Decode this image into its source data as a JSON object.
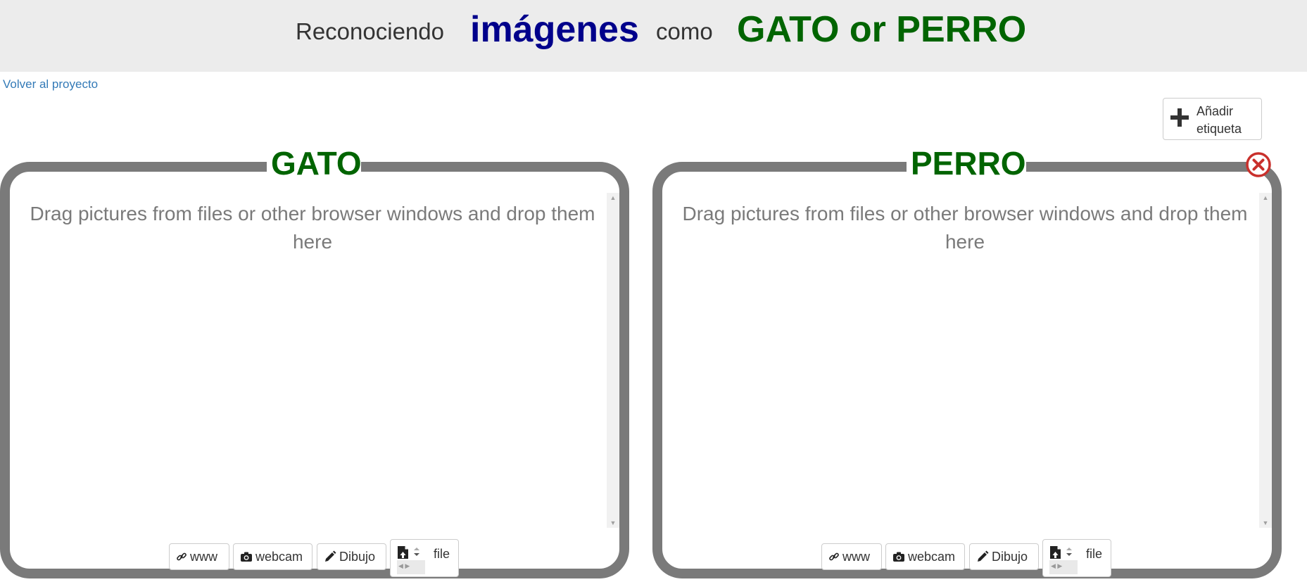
{
  "header": {
    "title_part1": "Reconociendo",
    "title_part2": "imágenes",
    "title_part3": "como",
    "title_part4": "GATO or PERRO"
  },
  "nav": {
    "back_link": "Volver al proyecto"
  },
  "add_label_button": {
    "label": "Añadir etiqueta",
    "icon": "plus-icon"
  },
  "buckets": [
    {
      "label": "GATO",
      "drop_hint": "Drag pictures from files or other browser windows and drop them here",
      "buttons": {
        "www": "www",
        "webcam": "webcam",
        "draw": "Dibujo",
        "file": "file"
      }
    },
    {
      "label": "PERRO",
      "drop_hint": "Drag pictures from files or other browser windows and drop them here",
      "buttons": {
        "www": "www",
        "webcam": "webcam",
        "draw": "Dibujo",
        "file": "file"
      }
    }
  ],
  "colors": {
    "title_blue": "#00008b",
    "label_green": "#006400",
    "bucket_border": "#7a7a7a",
    "link_blue": "#337ab7",
    "close_red": "#c9302c"
  }
}
